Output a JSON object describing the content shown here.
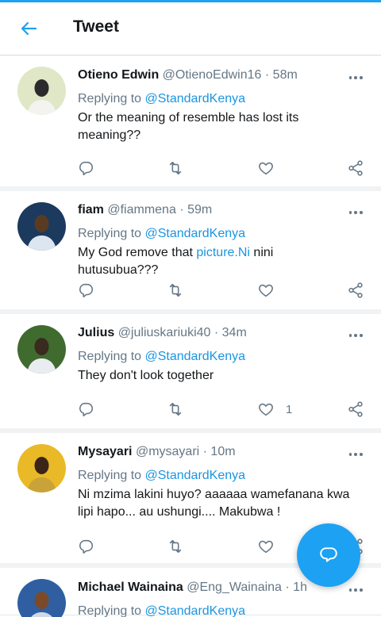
{
  "header": {
    "title": "Tweet",
    "back_icon": "arrow-left-icon"
  },
  "tweets": [
    {
      "name": "Otieno Edwin",
      "handle": "@OtienoEdwin16",
      "time": "· 58m",
      "replying_prefix": "Replying to ",
      "replying_to": "@StandardKenya",
      "body_parts": [
        {
          "text": "Or the meaning of resemble has lost its meaning??",
          "link": false
        }
      ],
      "like_count": ""
    },
    {
      "name": "fiam",
      "handle": "@fiammena",
      "time": "· 59m",
      "replying_prefix": "Replying to ",
      "replying_to": "@StandardKenya",
      "body_parts": [
        {
          "text": "My God remove that ",
          "link": false
        },
        {
          "text": "picture.Ni",
          "link": true
        },
        {
          "text": " nini hutusubua???",
          "link": false
        }
      ],
      "like_count": ""
    },
    {
      "name": "Julius",
      "handle": "@juliuskariuki40",
      "time": "· 34m",
      "replying_prefix": "Replying to ",
      "replying_to": "@StandardKenya",
      "body_parts": [
        {
          "text": "They don't look together",
          "link": false
        }
      ],
      "like_count": "1"
    },
    {
      "name": "Mysayari",
      "handle": "@mysayari",
      "time": "· 10m",
      "replying_prefix": "Replying to ",
      "replying_to": "@StandardKenya",
      "body_parts": [
        {
          "text": "Ni mzima lakini huyo? aaaaaa wamefanana kwa lipi hapo... au ushungi.... Makubwa !",
          "link": false
        }
      ],
      "like_count": ""
    },
    {
      "name": "Michael Wainaina",
      "handle": "@Eng_Wainaina",
      "time": "· 1h",
      "replying_prefix": "Replying to ",
      "replying_to": "@StandardKenya",
      "body_parts": [],
      "like_count": ""
    }
  ],
  "icons": {
    "reply": "reply-icon",
    "retweet": "retweet-icon",
    "like": "heart-icon",
    "share": "share-icon",
    "more": "more-options-icon",
    "compose": "compose-reply-icon"
  },
  "colors": {
    "accent": "#1da1f2",
    "link": "#1b95e0",
    "muted": "#657786"
  }
}
